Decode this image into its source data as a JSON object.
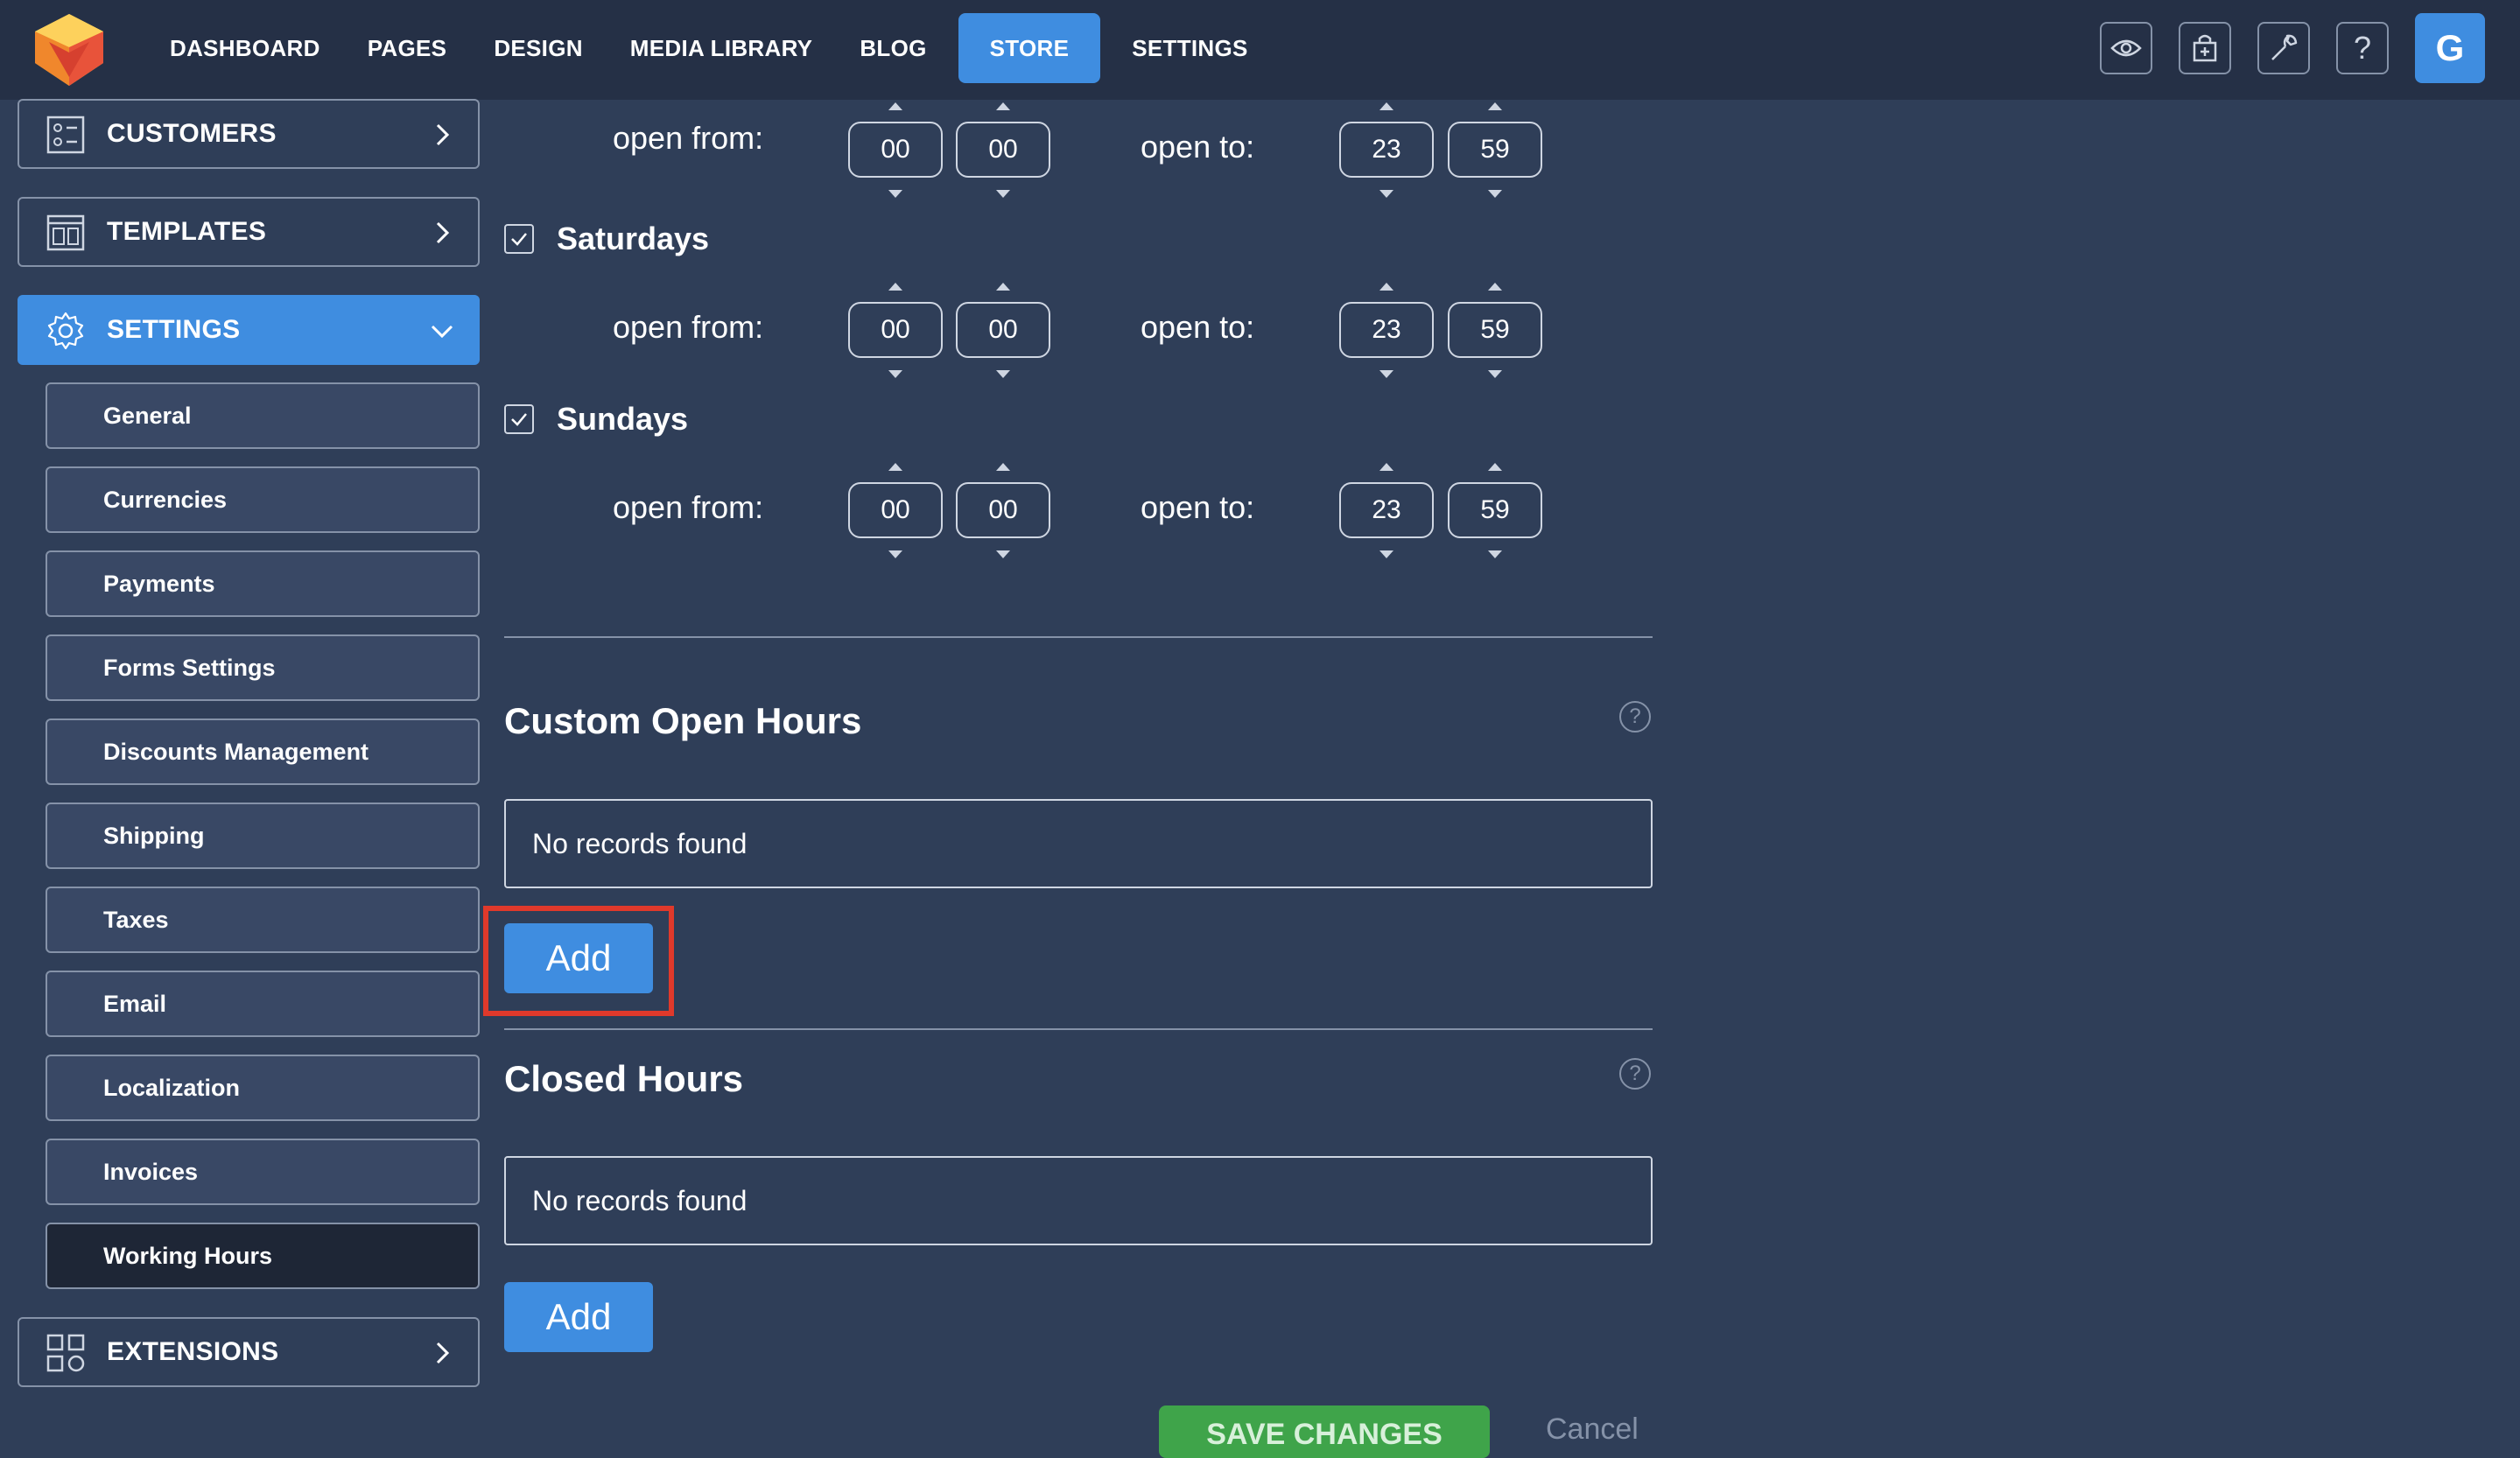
{
  "topbar": {
    "nav": [
      "DASHBOARD",
      "PAGES",
      "DESIGN",
      "MEDIA LIBRARY",
      "BLOG",
      "STORE",
      "SETTINGS"
    ],
    "active_nav": "STORE",
    "tools": [
      "eye-icon",
      "store-add-icon",
      "wrench-icon",
      "help-icon"
    ],
    "help_glyph": "?",
    "avatar_letter": "G",
    "accent_color": "#3f8de0"
  },
  "sidebar": {
    "customers": "CUSTOMERS",
    "templates": "TEMPLATES",
    "settings": "SETTINGS",
    "sub_items": [
      "General",
      "Currencies",
      "Payments",
      "Forms Settings",
      "Discounts Management",
      "Shipping",
      "Taxes",
      "Email",
      "Localization",
      "Invoices",
      "Working Hours"
    ],
    "active_sub": "Working Hours",
    "extensions": "EXTENSIONS"
  },
  "hours": {
    "open_from_label": "open from:",
    "open_to_label": "open to:",
    "rows": [
      {
        "day": "",
        "from_h": "00",
        "from_m": "00",
        "to_h": "23",
        "to_m": "59"
      },
      {
        "day": "Saturdays",
        "checked": true,
        "from_h": "00",
        "from_m": "00",
        "to_h": "23",
        "to_m": "59"
      },
      {
        "day": "Sundays",
        "checked": true,
        "from_h": "00",
        "from_m": "00",
        "to_h": "23",
        "to_m": "59"
      }
    ]
  },
  "custom_open_hours": {
    "title": "Custom Open Hours",
    "help": "?",
    "empty_text": "No records found",
    "add_label": "Add"
  },
  "closed_hours": {
    "title": "Closed Hours",
    "help": "?",
    "empty_text": "No records found",
    "add_label": "Add"
  },
  "footer": {
    "save_label": "SAVE CHANGES",
    "cancel_label": "Cancel",
    "save_color": "#3fa44a"
  }
}
